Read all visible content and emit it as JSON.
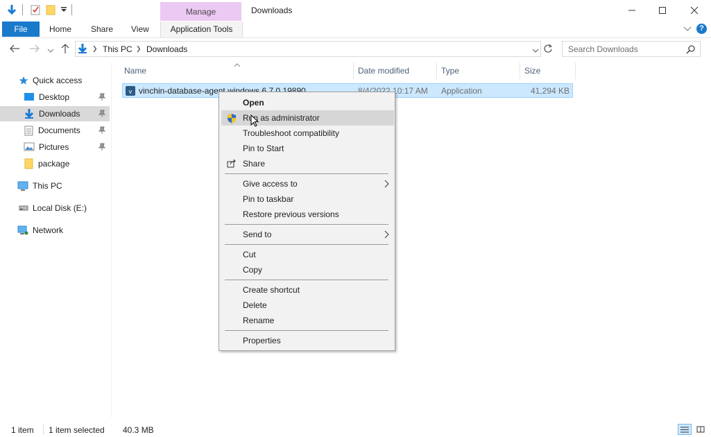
{
  "titlebar": {
    "manage_label": "Manage",
    "window_title": "Downloads"
  },
  "ribbon": {
    "file": "File",
    "home": "Home",
    "share": "Share",
    "view": "View",
    "app_tools": "Application Tools"
  },
  "address": {
    "crumbs": [
      "This PC",
      "Downloads"
    ],
    "search_placeholder": "Search Downloads"
  },
  "sidebar": {
    "items": [
      {
        "label": "Quick access"
      },
      {
        "label": "Desktop"
      },
      {
        "label": "Downloads"
      },
      {
        "label": "Documents"
      },
      {
        "label": "Pictures"
      },
      {
        "label": "package"
      },
      {
        "label": "This PC"
      },
      {
        "label": "Local Disk (E:)"
      },
      {
        "label": "Network"
      }
    ]
  },
  "columns": {
    "name": "Name",
    "date": "Date modified",
    "type": "Type",
    "size": "Size"
  },
  "file": {
    "name": "vinchin-database-agent windows 6.7.0.19890",
    "date": "8/4/2022 10:17 AM",
    "type": "Application",
    "size": "41,294 KB"
  },
  "context_menu": {
    "open": "Open",
    "run_admin": "Run as administrator",
    "troubleshoot": "Troubleshoot compatibility",
    "pin_start": "Pin to Start",
    "share": "Share",
    "give_access": "Give access to",
    "pin_taskbar": "Pin to taskbar",
    "restore": "Restore previous versions",
    "send_to": "Send to",
    "cut": "Cut",
    "copy": "Copy",
    "create_shortcut": "Create shortcut",
    "delete": "Delete",
    "rename": "Rename",
    "properties": "Properties"
  },
  "status": {
    "count": "1 item",
    "selected": "1 item selected",
    "size": "40.3 MB"
  },
  "colors": {
    "accent": "#1979ca",
    "manage": "#ecc9f3",
    "selection": "#cce8ff"
  }
}
